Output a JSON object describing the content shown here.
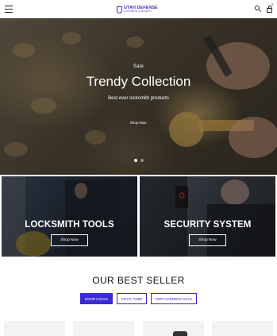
{
  "header": {
    "brand_name": "UTAH DEFENSE",
    "brand_tagline": "LOCKSMITH & SECURITY",
    "cart_count": "0"
  },
  "hero": {
    "kicker": "Sale",
    "title": "Trendy Collection",
    "subtitle": "Best ever locksmith products",
    "button_label": "Shop Now",
    "slides": 2,
    "active_slide": 1
  },
  "categories": [
    {
      "title": "LOCKSMITH TOOLS",
      "button_label": "Shop Now"
    },
    {
      "title": "SECURITY SYSTEM",
      "button_label": "Shop Now"
    }
  ],
  "best_seller": {
    "title": "OUR BEST SELLER",
    "tabs": [
      {
        "label": "DOOR LOCKS",
        "active": true
      },
      {
        "label": "KEYS, FOBS",
        "active": false
      },
      {
        "label": "REPLACEMENT KEYS",
        "active": false
      }
    ]
  },
  "colors": {
    "accent": "#3b2bd0",
    "text": "#111111",
    "background": "#ffffff"
  }
}
